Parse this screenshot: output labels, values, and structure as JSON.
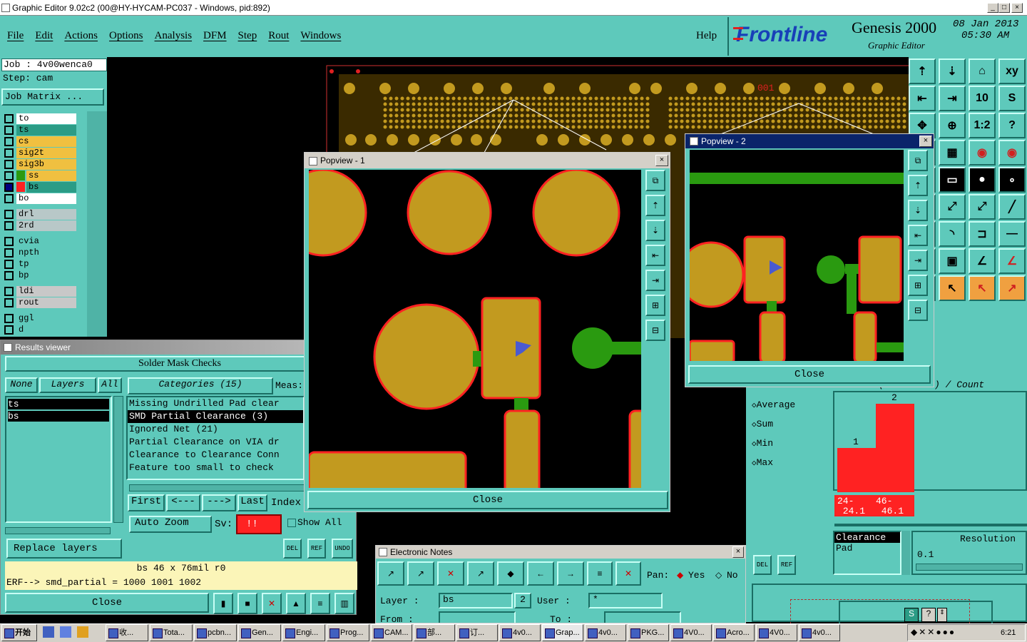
{
  "window": {
    "title": "Graphic Editor 9.02c2 (00@HY-HYCAM-PC037 - Windows, pid:892)"
  },
  "menu": [
    "File",
    "Edit",
    "Actions",
    "Options",
    "Analysis",
    "DFM",
    "Step",
    "Rout",
    "Windows"
  ],
  "help": "Help",
  "brand": {
    "logo": "Frontline",
    "product": "Genesis 2000",
    "subtitle": "Graphic Editor",
    "date": "08 Jan 2013",
    "time": "05:30 AM"
  },
  "job": {
    "job_label": "Job  : 4v00wenca0",
    "step_label": "Step: cam",
    "matrix_btn": "Job Matrix ..."
  },
  "layers": [
    {
      "name": "to",
      "color": "#ffffff"
    },
    {
      "name": "ts",
      "color": "#2b9c86"
    },
    {
      "name": "cs",
      "color": "#f0c040"
    },
    {
      "name": "sig2t",
      "color": "#f0c040"
    },
    {
      "name": "sig3b",
      "color": "#f0c040"
    },
    {
      "name": "ss",
      "color": "#f0c040"
    },
    {
      "name": "bs",
      "color": "#2b9c86"
    },
    {
      "name": "bo",
      "color": "#ffffff"
    },
    {
      "name": "drl",
      "color": "#b8c8c8"
    },
    {
      "name": "2rd",
      "color": "#b8c8c8"
    },
    {
      "name": "cvia",
      "color": "#5ec9bb"
    },
    {
      "name": "npth",
      "color": "#5ec9bb"
    },
    {
      "name": "tp",
      "color": "#5ec9bb"
    },
    {
      "name": "bp",
      "color": "#5ec9bb"
    },
    {
      "name": "ldi",
      "color": "#c8c8c8"
    },
    {
      "name": "rout",
      "color": "#c8c8c8"
    },
    {
      "name": "ggl",
      "color": "#5ec9bb"
    },
    {
      "name": "d",
      "color": "#5ec9bb"
    }
  ],
  "results": {
    "title": "Results viewer",
    "header": "Solder Mask Checks",
    "none": "None",
    "layers": "Layers",
    "all": "All",
    "layer_list": [
      "ts",
      "bs"
    ],
    "categories_label": "Categories (15)",
    "meas": "Meas:",
    "categories": [
      "Missing Undrilled Pad clear",
      "SMD Partial Clearance (3)",
      "Ignored Net (21)",
      "Partial Clearance on VIA dr",
      "Clearance to Clearance Conn",
      "Feature too small to check"
    ],
    "first": "First",
    "prev": "<---",
    "next": "--->",
    "last": "Last",
    "index": "Index",
    "auto_zoom": "Auto Zoom",
    "sv": "Sv:",
    "sv_val": "!!",
    "show_all": "Show All",
    "replace_layers": "Replace layers",
    "status1": "bs 46 x 76mil  r0",
    "status2": "ERF--> smd_partial = 1000 1001 1002",
    "close": "Close",
    "del": "DEL",
    "ref": "REF",
    "undo": "UNDO"
  },
  "popview1": {
    "title": "Popview - 1",
    "close": "Close"
  },
  "popview2": {
    "title": "Popview - 2",
    "close": "Close"
  },
  "stats": {
    "header": "(Clearance) / Count",
    "options": [
      "Average",
      "Sum",
      "Min",
      "Max"
    ],
    "bars": [
      {
        "label": "1",
        "range": "24-\n 24.1",
        "value": 1
      },
      {
        "label": "2",
        "range": "46-\n 46.1",
        "value": 2
      }
    ],
    "clearance": "Clearance",
    "pad": "Pad",
    "resolution": "Resolution",
    "res_val": "0.1",
    "del": "DEL",
    "ref": "REF"
  },
  "notes": {
    "title": "Electronic Notes",
    "pan": "Pan:",
    "yes": "Yes",
    "no": "No",
    "layer_label": "Layer :",
    "layer_val": "bs",
    "num": "2",
    "user_label": "User :",
    "user_val": "*",
    "from": "From  :",
    "to": "To   :"
  },
  "pcb": {
    "label": "001"
  },
  "taskbar": {
    "start": "开始",
    "items": [
      "收...",
      "Tota...",
      "pcbn...",
      "Gen...",
      "Engi...",
      "Prog...",
      "CAM...",
      "部...",
      "订...",
      "4v0...",
      "Grap...",
      "4v0...",
      "PKG...",
      "4V0...",
      "Acro...",
      "4V0...",
      "4v0..."
    ],
    "clock": "6:21"
  }
}
